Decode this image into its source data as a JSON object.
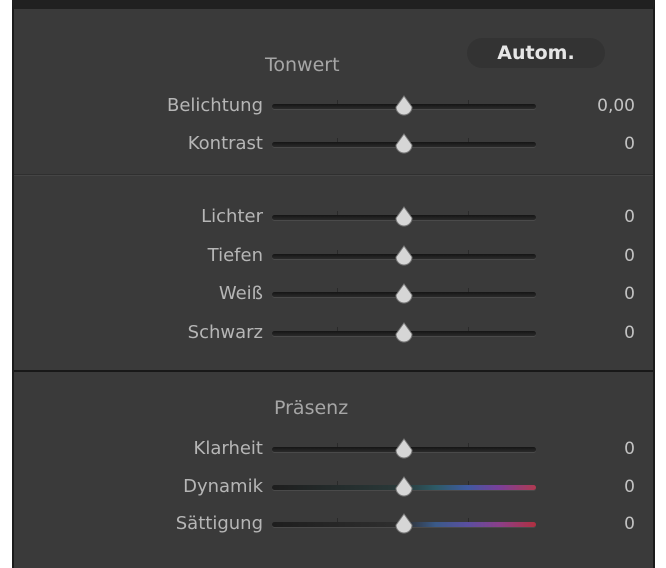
{
  "panel": {
    "sections": {
      "tonwert_title": "Tonwert",
      "auto_button": "Autom.",
      "praesenz_title": "Präsenz"
    },
    "sliders": [
      {
        "id": "belichtung",
        "label": "Belichtung",
        "value": "0,00",
        "position": 0.5,
        "track": "plain"
      },
      {
        "id": "kontrast",
        "label": "Kontrast",
        "value": "0",
        "position": 0.5,
        "track": "plain"
      },
      {
        "id": "lichter",
        "label": "Lichter",
        "value": "0",
        "position": 0.5,
        "track": "plain"
      },
      {
        "id": "tiefen",
        "label": "Tiefen",
        "value": "0",
        "position": 0.5,
        "track": "plain"
      },
      {
        "id": "weiss",
        "label": "Weiß",
        "value": "0",
        "position": 0.5,
        "track": "plain"
      },
      {
        "id": "schwarz",
        "label": "Schwarz",
        "value": "0",
        "position": 0.5,
        "track": "plain"
      },
      {
        "id": "klarheit",
        "label": "Klarheit",
        "value": "0",
        "position": 0.5,
        "track": "plain"
      },
      {
        "id": "dynamik",
        "label": "Dynamik",
        "value": "0",
        "position": 0.5,
        "track": "color-dyn"
      },
      {
        "id": "saettigung",
        "label": "Sättigung",
        "value": "0",
        "position": 0.5,
        "track": "color-sat"
      }
    ]
  },
  "colors": {
    "panel_bg": "#3a3a3a",
    "label_text": "#b6b6b6",
    "thumb": "#d8d8d8"
  }
}
